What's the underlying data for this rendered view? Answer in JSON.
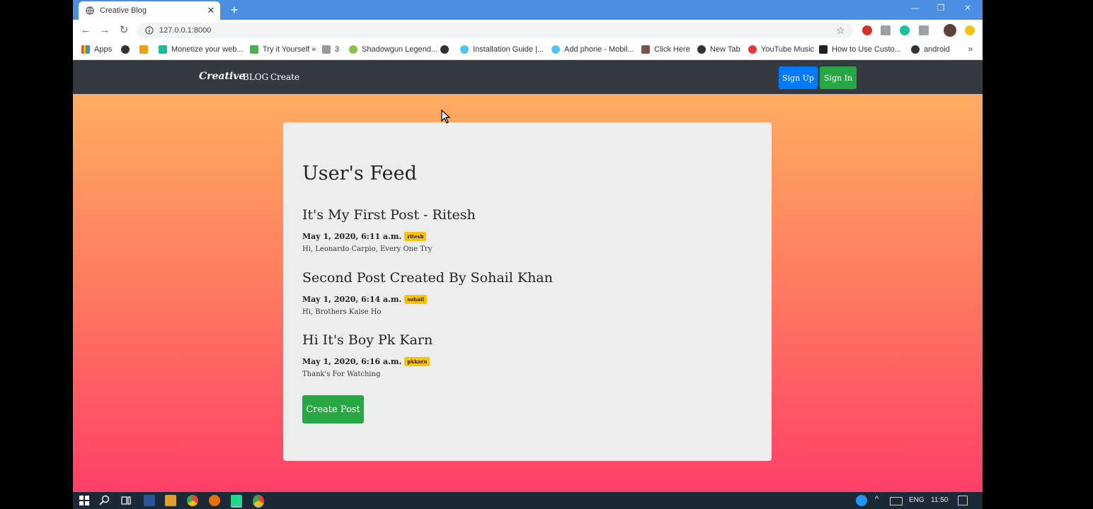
{
  "browser": {
    "tab_title": "Creative Blog",
    "url": "127.0.0.1:8000",
    "bookmarks": [
      {
        "label": "Apps"
      },
      {
        "label": ""
      },
      {
        "label": ""
      },
      {
        "label": "Monetize your web..."
      },
      {
        "label": "Try it Yourself »"
      },
      {
        "label": "3"
      },
      {
        "label": "Shadowgun Legend..."
      },
      {
        "label": ""
      },
      {
        "label": "Installation Guide |..."
      },
      {
        "label": "Add phone - Mobil..."
      },
      {
        "label": "Click Here"
      },
      {
        "label": "New Tab"
      },
      {
        "label": "YouTube Music"
      },
      {
        "label": "How to Use Custo..."
      },
      {
        "label": "android"
      }
    ],
    "bookmarks_more": "»"
  },
  "site_nav": {
    "brand": "Creative",
    "links": [
      "BLOG",
      "Create"
    ],
    "signup_label": "Sign Up",
    "signin_label": "Sign In"
  },
  "feed": {
    "title": "User's Feed",
    "posts": [
      {
        "title": "It's My First Post - Ritesh",
        "date": "May 1, 2020, 6:11 a.m.",
        "author": "ritesh",
        "body": "Hi, Leonardo Carpio, Every One Try"
      },
      {
        "title": "Second Post Created By Sohail Khan",
        "date": "May 1, 2020, 6:14 a.m.",
        "author": "sohail",
        "body": "Hi, Brothers Kaise Ho"
      },
      {
        "title": "Hi It's Boy Pk Karn",
        "date": "May 1, 2020, 6:16 a.m.",
        "author": "pkkarn",
        "body": "Thank's For Watching"
      }
    ],
    "create_label": "Create Post"
  },
  "taskbar": {
    "lang": "ENG",
    "time": "11:50"
  },
  "colors": {
    "tabbar": "#4a8fe2",
    "navbar": "#343a40",
    "primary": "#007bff",
    "success": "#28a745",
    "warning": "#ffc107"
  }
}
